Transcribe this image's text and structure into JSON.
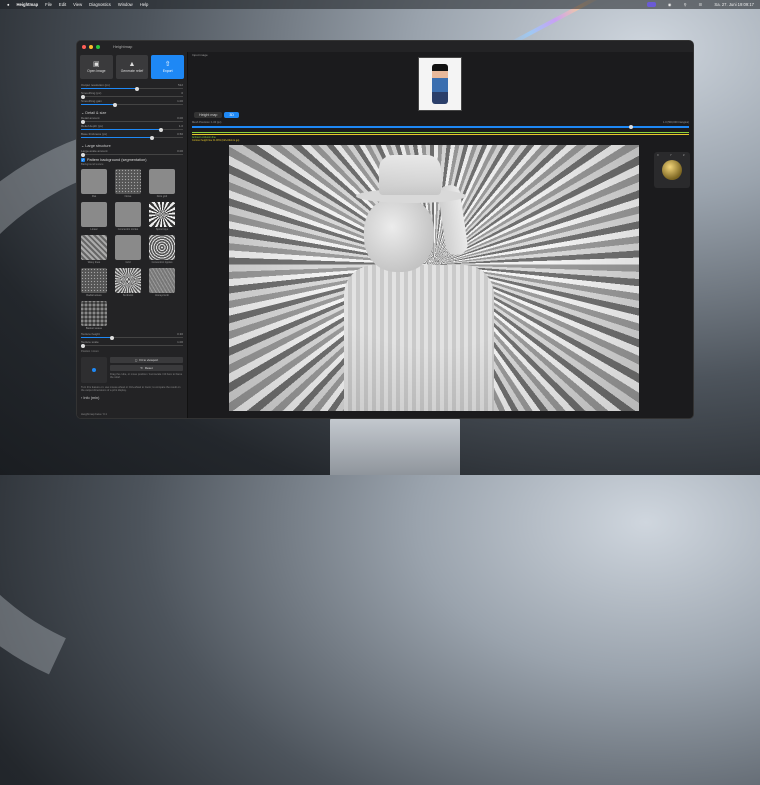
{
  "menubar": {
    "app_name": "Heightmap",
    "items": [
      "File",
      "Edit",
      "View",
      "Diagnostics",
      "Window",
      "Help"
    ],
    "clock": "Sa. 27. Juni 19:09:17"
  },
  "window": {
    "title": "Heightmap"
  },
  "toolbar": {
    "open_label": "Open image",
    "generate_label": "Generate relief",
    "export_label": "Export"
  },
  "sliders": [
    {
      "label": "Output resolution (px)",
      "value": "512",
      "fraction": 0.55
    },
    {
      "label": "Smoothing (px)",
      "value": "0",
      "fraction": 0.02
    },
    {
      "label": "Smoothing gain",
      "value": "1.00",
      "fraction": 0.33
    }
  ],
  "detail_section": {
    "title": "Detail & size",
    "sliders": [
      {
        "label": "Detail amount",
        "value": "0.00",
        "fraction": 0.02
      },
      {
        "label": "Relief depth (px)",
        "value": "1.0",
        "fraction": 0.78
      },
      {
        "label": "Base thickness (px)",
        "value": "0.50",
        "fraction": 0.7
      }
    ]
  },
  "structure_section": {
    "title": "Large structure",
    "slider": {
      "label": "Large-scale amount",
      "value": "0.00",
      "fraction": 0.02
    }
  },
  "pattern": {
    "checkbox_label": "Pattern background (segmentation)",
    "subtitle": "Background texture",
    "tiles": [
      {
        "label": "Flat",
        "style": "flat"
      },
      {
        "label": "Noise",
        "style": "noise"
      },
      {
        "label": "Dots grid",
        "style": "flat"
      },
      {
        "label": "Linear",
        "style": "flat"
      },
      {
        "label": "Concentric circles",
        "style": "flat"
      },
      {
        "label": "Spiral rays",
        "style": "spiral"
      },
      {
        "label": "Wavy lines",
        "style": "wave"
      },
      {
        "label": "Grid",
        "style": "flat"
      },
      {
        "label": "Concentric ripples",
        "style": "ripple"
      },
      {
        "label": "Radial waves",
        "style": "noise"
      },
      {
        "label": "Sunburst",
        "style": "rays"
      },
      {
        "label": "Honeycomb",
        "style": "honey"
      },
      {
        "label": "Basket weave",
        "style": "weave"
      }
    ],
    "sliders": [
      {
        "label": "Texture height",
        "value": "0.30",
        "fraction": 0.3
      },
      {
        "label": "Texture scale",
        "value": "1.00",
        "fraction": 0.02
      }
    ]
  },
  "viewport": {
    "title": "Position / zoom",
    "fit_label": "Fit to viewport",
    "reset_label": "Reset",
    "help1": "Drag the cube, or move position / zoomscale / tilt here to frame the relief.",
    "help2": "Turn this feature on: use mouse wheel or Ctrl+wheel to zoom; to compare the result on the output dimensions of a print display."
  },
  "info": {
    "label": "Info (min)"
  },
  "footer": {
    "text": "Heightmap beta / 0.1"
  },
  "main": {
    "input_label": "Input image",
    "toggle": [
      "Height map",
      "3D"
    ],
    "toggle_selected": 1,
    "mesh_label": "Mesh Precision: 1.00 (px)",
    "mesh_value": "1.0 (500,000 triangles)",
    "mesh_fraction": 0.88,
    "green_label": "Ambient occlusion line",
    "yellow_label": "Contour height line ±1.00% (Ctrl+Click to go)",
    "axis": [
      "X",
      "Y",
      "Z"
    ]
  },
  "colors": {
    "accent": "#1e88f5",
    "green": "#8bd23a",
    "yellow": "#e6c62a"
  }
}
